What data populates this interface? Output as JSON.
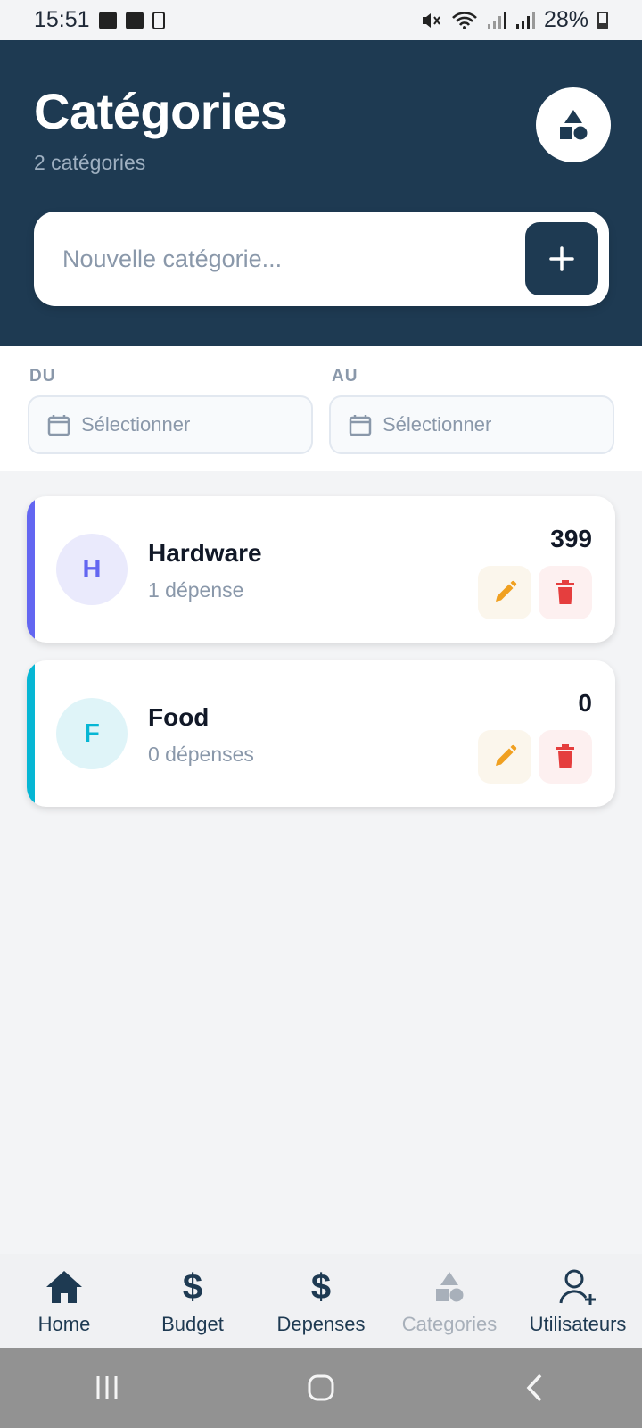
{
  "status_bar": {
    "time": "15:51",
    "battery": "28%",
    "icons": [
      "image-icon",
      "checkbox-icon",
      "phone-icon",
      "mute-icon",
      "wifi-icon",
      "signal-icon",
      "signal-icon",
      "battery-icon"
    ]
  },
  "header": {
    "title": "Catégories",
    "subtitle": "2 catégories",
    "badge_icon": "shapes-icon",
    "new_category": {
      "value": "",
      "placeholder": "Nouvelle catégorie...",
      "add_icon": "plus-icon"
    }
  },
  "filters": {
    "from": {
      "label": "DU",
      "placeholder": "Sélectionner",
      "icon": "calendar-icon"
    },
    "to": {
      "label": "AU",
      "placeholder": "Sélectionner",
      "icon": "calendar-icon"
    }
  },
  "categories": [
    {
      "initial": "H",
      "name": "Hardware",
      "count_label": "1 dépense",
      "total": "399",
      "accent": "#6366f1",
      "avatar_bg": "#eaeafc",
      "avatar_color": "#6366f1"
    },
    {
      "initial": "F",
      "name": "Food",
      "count_label": "0 dépenses",
      "total": "0",
      "accent": "#06b6d4",
      "avatar_bg": "#dff4f8",
      "avatar_color": "#06b6d4"
    }
  ],
  "bottom_nav": {
    "items": [
      {
        "label": "Home",
        "icon": "home-icon",
        "active": false
      },
      {
        "label": "Budget",
        "icon": "dollar-icon",
        "active": false
      },
      {
        "label": "Depenses",
        "icon": "dollar-icon",
        "active": false
      },
      {
        "label": "Categories",
        "icon": "shapes-icon",
        "active": true
      },
      {
        "label": "Utilisateurs",
        "icon": "user-add-icon",
        "active": false
      }
    ]
  },
  "system_nav": [
    "recents-icon",
    "home-circle-icon",
    "back-icon"
  ],
  "colors": {
    "primary": "#1e3a52",
    "edit": "#f0a020",
    "delete": "#e53e3e",
    "muted": "#8a98aa"
  }
}
